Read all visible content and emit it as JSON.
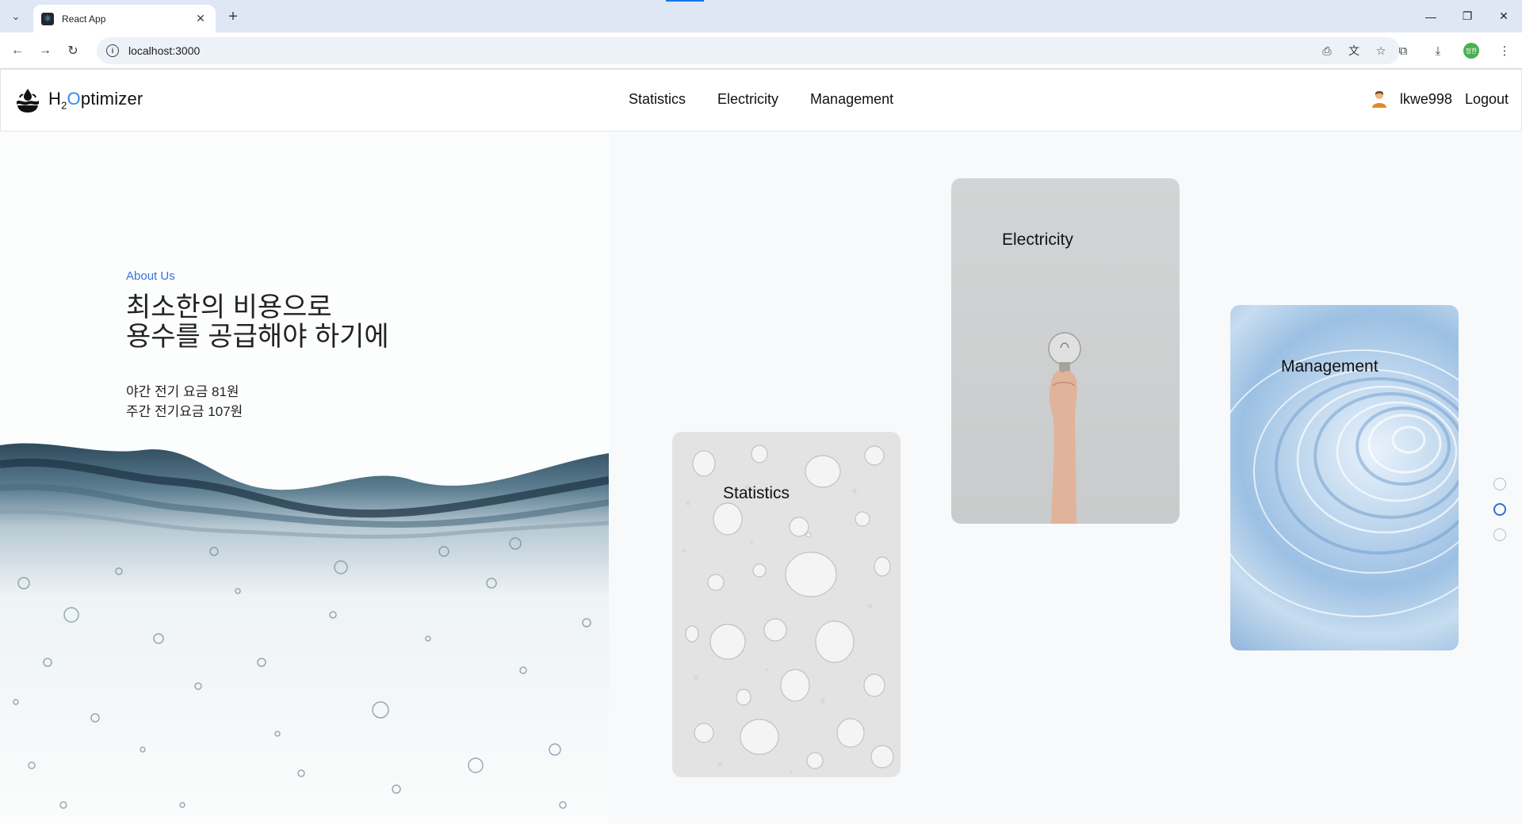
{
  "browser": {
    "tab_title": "React App",
    "url": "localhost:3000",
    "profile_initials": "정한"
  },
  "header": {
    "logo_h": "H",
    "logo_sub": "2",
    "logo_o": "O",
    "logo_rest": "ptimizer",
    "nav": [
      "Statistics",
      "Electricity",
      "Management"
    ],
    "username": "lkwe998",
    "logout_label": "Logout"
  },
  "hero": {
    "eyebrow": "About Us",
    "headline_line1": "최소한의 비용으로",
    "headline_line2": "용수를 공급해야 하기에",
    "price_line1": "야간 전기 요금 81원",
    "price_line2": "주간 전기요금 107원"
  },
  "cards": {
    "statistics": "Statistics",
    "electricity": "Electricity",
    "management": "Management"
  },
  "pager": {
    "count": 3,
    "active_index": 1
  },
  "colors": {
    "accent": "#3a6fe0",
    "logo_o": "#2d8cf0",
    "pager_active": "#2f6fd6"
  }
}
